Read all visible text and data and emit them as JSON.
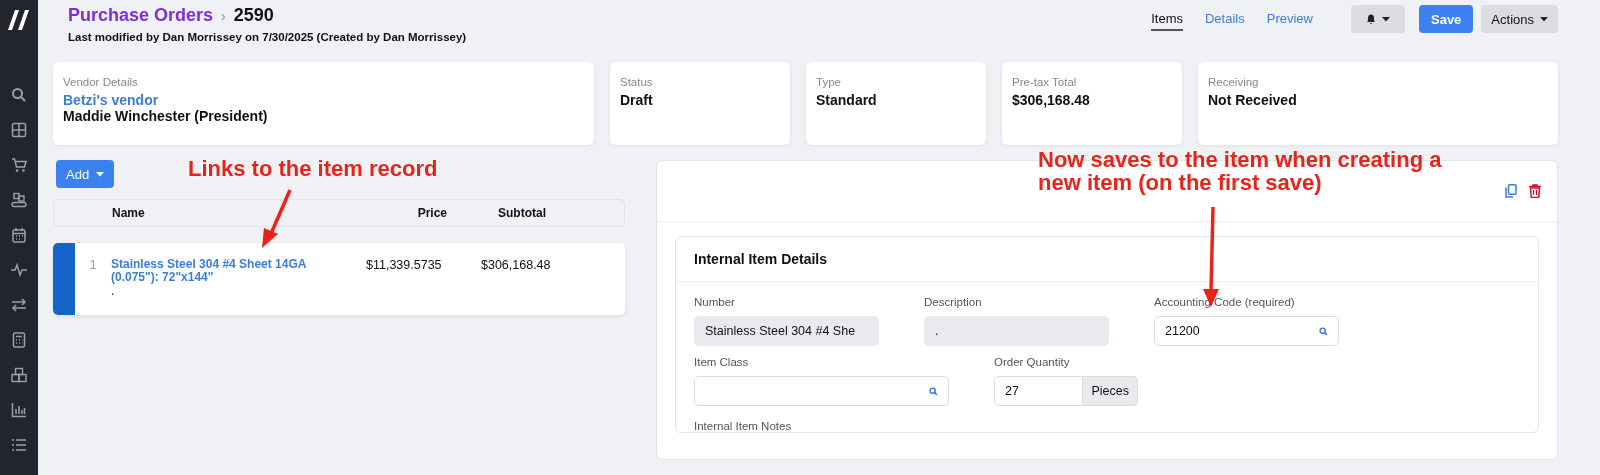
{
  "sidebar": {
    "icons": [
      {
        "kind": "search"
      },
      {
        "kind": "grid"
      },
      {
        "kind": "cart"
      },
      {
        "kind": "conveyor"
      },
      {
        "kind": "calendar"
      },
      {
        "kind": "pulse"
      },
      {
        "kind": "transfer"
      },
      {
        "kind": "calculator"
      },
      {
        "kind": "boxes"
      },
      {
        "kind": "chart"
      },
      {
        "kind": "list"
      }
    ]
  },
  "header": {
    "breadcrumb": "Purchase Orders",
    "separator": "›",
    "record": "2590",
    "subtitle": "Last modified by Dan Morrissey on 7/30/2025 (Created by Dan Morrissey)"
  },
  "tabs": [
    {
      "label": "Items",
      "selected": true
    },
    {
      "label": "Details",
      "selected": false
    },
    {
      "label": "Preview",
      "selected": false
    }
  ],
  "buttons": {
    "save": "Save",
    "actions": "Actions"
  },
  "vendor": {
    "label": "Vendor Details",
    "name": "Betzi's vendor",
    "contact": "Maddie Winchester (President)"
  },
  "summary": [
    {
      "label": "Status",
      "value": "Draft"
    },
    {
      "label": "Type",
      "value": "Standard"
    },
    {
      "label": "Pre-tax Total",
      "value": "$306,168.48"
    },
    {
      "label": "Receiving",
      "value": "Not Received"
    }
  ],
  "add_button": "Add",
  "table": {
    "columns": [
      "Name",
      "Price",
      "Subtotal"
    ],
    "rows": [
      {
        "index": "1",
        "name": "Stainless Steel 304 #4 Sheet 14GA (0.075\"): 72\"x144\"",
        "description": ".",
        "price": "$11,339.5735",
        "subtotal": "$306,168.48",
        "selected": true
      }
    ]
  },
  "detail": {
    "title": "Internal Item Details",
    "fields": [
      {
        "label": "Number",
        "value": "Stainless Steel 304 #4 She",
        "kind": "readonly"
      },
      {
        "label": "Description",
        "value": ".",
        "kind": "readonly"
      },
      {
        "label": "Accounting Code (required)",
        "value": "21200",
        "kind": "search"
      },
      {
        "label": "Item Class",
        "kind": "search"
      },
      {
        "label": "Order Quantity",
        "value": "27",
        "unit": "Pieces",
        "kind": "unit"
      }
    ],
    "notes_label": "Internal Item Notes"
  },
  "annotations": [
    {
      "text": "Links to the item record"
    },
    {
      "text": "Now saves to the item when creating a new item (on the first save)"
    }
  ]
}
